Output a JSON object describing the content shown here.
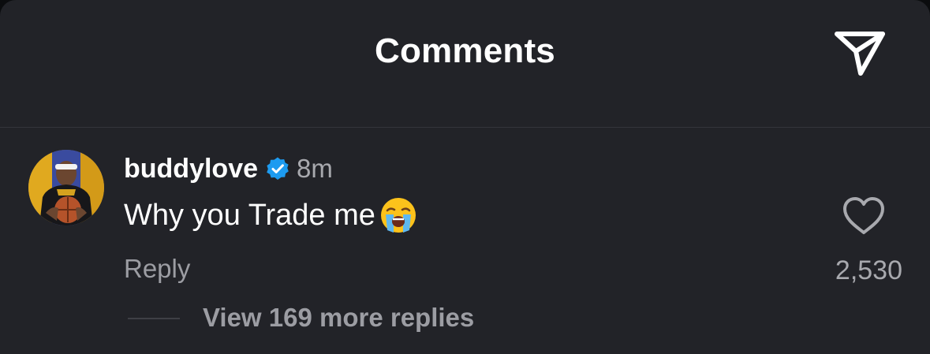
{
  "header": {
    "title": "Comments",
    "share_icon": "send-icon"
  },
  "comment": {
    "username": "buddylove",
    "verified": true,
    "verified_icon": "verified-badge-icon",
    "verified_color": "#1d9bf0",
    "time": "8m",
    "text": "Why you Trade me",
    "emoji": "loudly-crying-face",
    "reply_label": "Reply",
    "like_icon": "heart-icon",
    "like_count": "2,530",
    "view_replies_label": "View 169 more replies"
  },
  "colors": {
    "background": "#222328",
    "primary_text": "#ffffff",
    "secondary_text": "#a8a9ae"
  }
}
